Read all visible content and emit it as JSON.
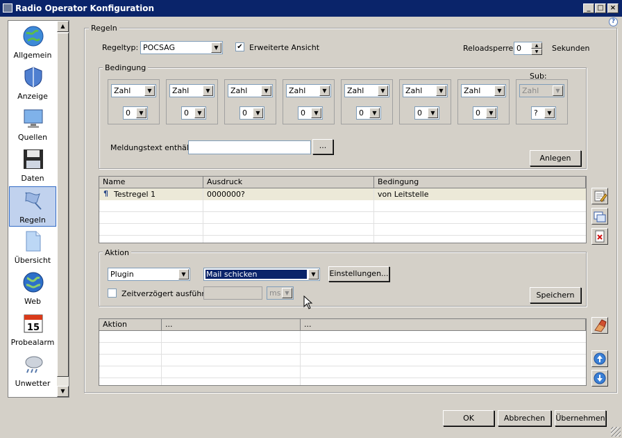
{
  "window": {
    "title": "Radio Operator Konfiguration",
    "help": "?"
  },
  "sidebar": {
    "items": [
      {
        "label": "Allgemein",
        "icon": "globe-icon"
      },
      {
        "label": "Anzeige",
        "icon": "shield-icon"
      },
      {
        "label": "Quellen",
        "icon": "monitor-icon"
      },
      {
        "label": "Daten",
        "icon": "floppy-disk-icon"
      },
      {
        "label": "Regeln",
        "icon": "flag-icon"
      },
      {
        "label": "Übersicht",
        "icon": "document-icon"
      },
      {
        "label": "Web",
        "icon": "globe-icon"
      },
      {
        "label": "Probealarm",
        "icon": "calendar-icon"
      },
      {
        "label": "Unwetter",
        "icon": "weather-icon"
      }
    ],
    "calendar_day": "15"
  },
  "regeln": {
    "group_label": "Regeln",
    "regeltyp_label": "Regeltyp:",
    "regeltyp_value": "POCSAG",
    "erweitert_label": "Erweiterte Ansicht",
    "erweitert_checked": true,
    "reload_label": "Reloadsperre:",
    "reload_value": "0",
    "sekunden_label": "Sekunden"
  },
  "bedingung": {
    "group_label": "Bedingung",
    "sub_label": "Sub:",
    "cells": [
      {
        "type": "Zahl",
        "num": "0"
      },
      {
        "type": "Zahl",
        "num": "0"
      },
      {
        "type": "Zahl",
        "num": "0"
      },
      {
        "type": "Zahl",
        "num": "0"
      },
      {
        "type": "Zahl",
        "num": "0"
      },
      {
        "type": "Zahl",
        "num": "0"
      },
      {
        "type": "Zahl",
        "num": "0"
      },
      {
        "type": "Zahl",
        "num": "?"
      }
    ],
    "meldung_label": "Meldungstext enthält:",
    "meldung_value": "",
    "browse_label": "...",
    "anlegen_label": "Anlegen"
  },
  "rules_table": {
    "columns": [
      "Name",
      "Ausdruck",
      "Bedingung"
    ],
    "rows": [
      {
        "name": "Testregel 1",
        "ausdruck": "0000000?",
        "bedingung": "von Leitstelle"
      }
    ]
  },
  "aktion": {
    "group_label": "Aktion",
    "type_value": "Plugin",
    "action_value": "Mail schicken",
    "settings_label": "Einstellungen...",
    "delay_label": "Zeitverzögert ausführen",
    "delay_checked": false,
    "delay_value": "",
    "unit_value": "ms",
    "save_label": "Speichern"
  },
  "action_table": {
    "columns": [
      "Aktion",
      "...",
      "..."
    ]
  },
  "footer": {
    "ok": "OK",
    "cancel": "Abbrechen",
    "apply": "Übernehmen"
  }
}
